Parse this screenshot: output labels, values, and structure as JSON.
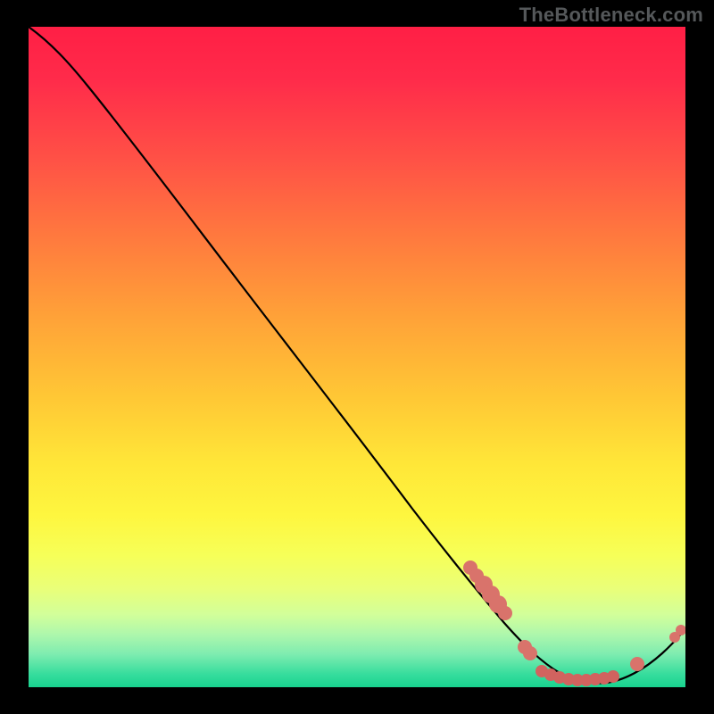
{
  "watermark": "TheBottleneck.com",
  "colors": {
    "background": "#000000",
    "point": "#d9736b",
    "curve": "#000000"
  },
  "chart_data": {
    "type": "line",
    "title": "",
    "xlabel": "",
    "ylabel": "",
    "xlim": [
      0,
      100
    ],
    "ylim": [
      0,
      100
    ],
    "note": "No axis ticks or labels are visible; values are normalized 0–100 on plot coordinates. Curve descends from top-left, reaches minimum near x≈82, then rises.",
    "series": [
      {
        "name": "bottleneck-curve",
        "x": [
          0,
          4,
          8,
          14,
          20,
          28,
          36,
          44,
          52,
          60,
          66,
          72,
          76,
          80,
          84,
          88,
          92,
          96,
          100
        ],
        "y": [
          100,
          98,
          95,
          90,
          84,
          74,
          64,
          54,
          44,
          34,
          26,
          18,
          12,
          6,
          3,
          2,
          3,
          6,
          10
        ]
      }
    ],
    "points": [
      {
        "x": 67,
        "y": 18
      },
      {
        "x": 68,
        "y": 17
      },
      {
        "x": 69,
        "y": 15
      },
      {
        "x": 70,
        "y": 14
      },
      {
        "x": 71,
        "y": 12
      },
      {
        "x": 72,
        "y": 11
      },
      {
        "x": 75,
        "y": 5
      },
      {
        "x": 76,
        "y": 4
      },
      {
        "x": 78,
        "y": 3
      },
      {
        "x": 80,
        "y": 2
      },
      {
        "x": 82,
        "y": 2
      },
      {
        "x": 84,
        "y": 2
      },
      {
        "x": 86,
        "y": 2
      },
      {
        "x": 88,
        "y": 2
      },
      {
        "x": 92,
        "y": 4
      },
      {
        "x": 98,
        "y": 8
      },
      {
        "x": 99,
        "y": 9
      }
    ]
  }
}
